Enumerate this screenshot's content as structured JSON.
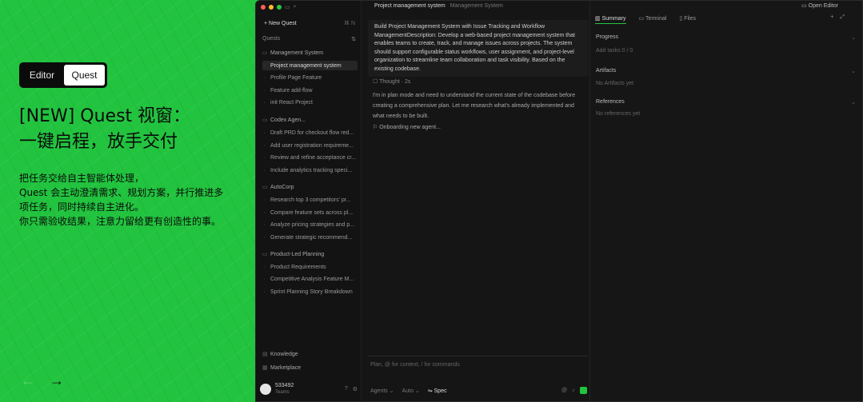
{
  "toggle": {
    "editor": "Editor",
    "quest": "Quest"
  },
  "headline": {
    "line1": "[NEW] Quest 视窗：",
    "line2": "一键启程，放手交付"
  },
  "desc": {
    "line1": "把任务交给自主智能体处理，",
    "line2": "Quest 会主动澄清需求、规划方案，并行推进多",
    "line3": "项任务，同时持续自主进化。",
    "line4": "你只需验收结果，注意力留给更有创造性的事。"
  },
  "nav": {
    "prev": "←",
    "next": "→"
  },
  "sidebar": {
    "new_quest": "New Quest",
    "new_quest_shortcut": "⌘ N",
    "section": "Quests",
    "section_icon": "⇅",
    "items": [
      {
        "label": "Management System",
        "type": "group"
      },
      {
        "label": "Project management system",
        "type": "child",
        "active": true
      },
      {
        "label": "Profile Page Feature",
        "type": "child"
      },
      {
        "label": "Feature add-flow",
        "type": "child"
      },
      {
        "label": "init React Project",
        "type": "child"
      },
      {
        "label": "Codex Agen...",
        "type": "group"
      },
      {
        "label": "Draft PRD for checkout flow red...",
        "type": "child"
      },
      {
        "label": "Add user registration requireme...",
        "type": "child"
      },
      {
        "label": "Review and refine acceptance cr...",
        "type": "child"
      },
      {
        "label": "Include analytics tracking speci...",
        "type": "child"
      },
      {
        "label": "AutoCorp",
        "type": "group"
      },
      {
        "label": "Research top 3 competitors' pr...",
        "type": "child"
      },
      {
        "label": "Compare feature sets across pl...",
        "type": "child"
      },
      {
        "label": "Analyze pricing strategies and p...",
        "type": "child"
      },
      {
        "label": "Generate strategic recommend...",
        "type": "child"
      },
      {
        "label": "Product-Led Planning",
        "type": "group"
      },
      {
        "label": "Product Requirements",
        "type": "child"
      },
      {
        "label": "Competitive Analysis Feature M...",
        "type": "child"
      },
      {
        "label": "Sprint Planning Story Breakdown",
        "type": "child"
      }
    ],
    "knowledge": "Knowledge",
    "marketplace": "Marketplace",
    "user": {
      "name": "533492",
      "plan": "Teams"
    }
  },
  "main": {
    "title": "Project management system",
    "crumb": "Management System",
    "prompt": "Build Project Management System with Issue Tracking and Workflow ManagementDescription: Develop a web-based project management system that enables teams to create, track, and manage issues across projects. The system should support configurable status workflows, user assignment, and project-level organization to streamline team collaboration and task visibility. Based on the existing codebase.",
    "thought": "Thought · 2s",
    "body": "I'm in plan mode and need to understand the current state of the codebase before creating a comprehensive plan. Let me research what's already implemented and what needs to be built.",
    "onboarding": "Onboarding new agent...",
    "input_placeholder": "Plan, @ for context, / for commands",
    "bar": {
      "agents": "Agents",
      "auto": "Auto",
      "spec": "Spec"
    }
  },
  "right": {
    "open_editor": "Open Editor",
    "tabs": [
      "Summary",
      "Terminal",
      "Files"
    ],
    "sections": [
      {
        "title": "Progress",
        "sub": "Add tasks 0 / 0"
      },
      {
        "title": "Artifacts",
        "sub": "No Artifacts yet"
      },
      {
        "title": "References",
        "sub": "No references yet"
      }
    ]
  }
}
